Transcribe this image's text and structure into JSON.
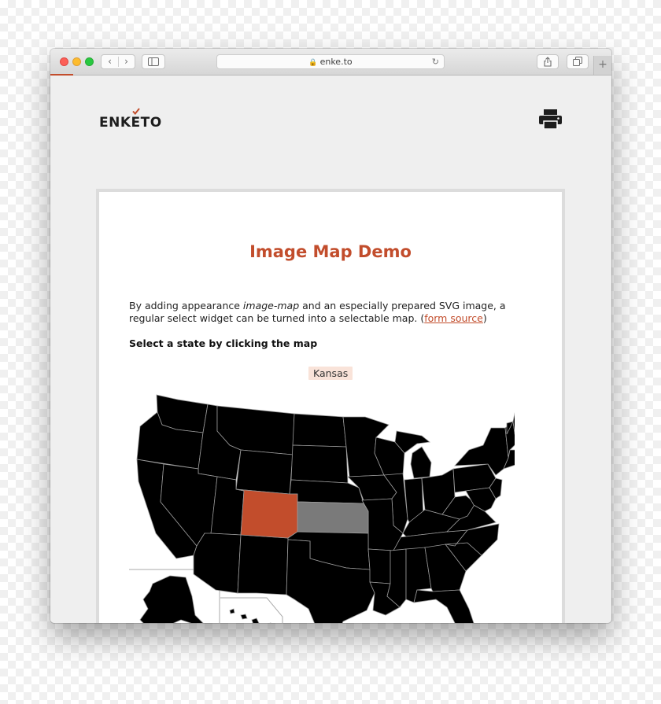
{
  "browser": {
    "url": "enke.to",
    "nav_back": "‹",
    "nav_forward": "›",
    "new_tab": "+"
  },
  "header": {
    "logo_text": "ENKETO"
  },
  "form": {
    "title": "Image Map Demo",
    "intro_before": "By adding appearance ",
    "intro_italic": "image-map",
    "intro_after": " and an especially prepared SVG image, a regular select widget can be turned into a selectable map. (",
    "intro_link": "form source",
    "intro_end": ")",
    "question_label": "Select a state by clicking the map",
    "selected_value": "Kansas"
  },
  "map": {
    "colors": {
      "default": "#000000",
      "selected": "#c24d2c",
      "hover": "#7a7a7a",
      "border": "#9a9a9a"
    }
  },
  "colors": {
    "accent": "#c24d2c",
    "badge_bg": "#f9e3d9"
  }
}
